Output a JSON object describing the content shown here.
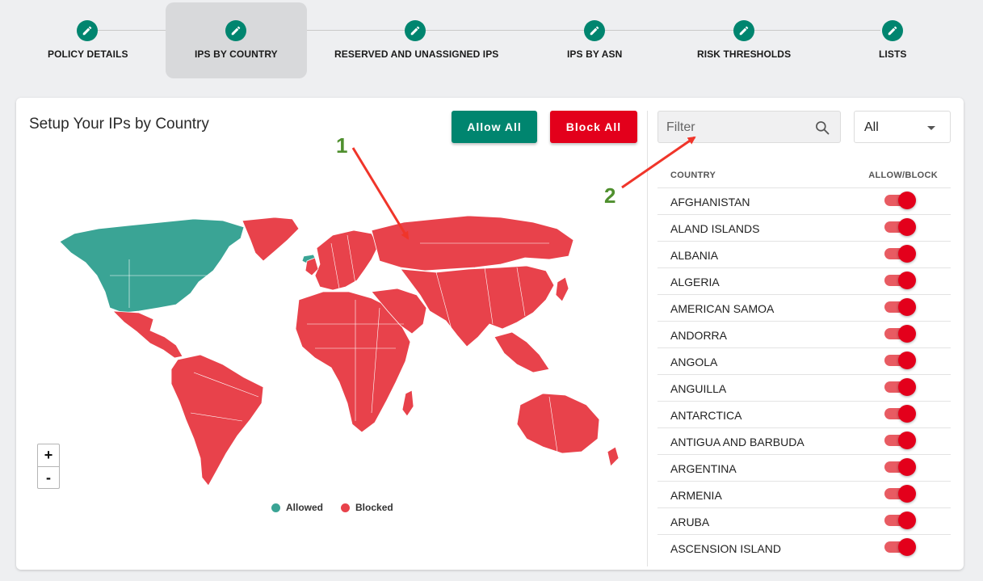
{
  "stepper": {
    "steps": [
      {
        "label": "POLICY DETAILS"
      },
      {
        "label": "IPS BY COUNTRY"
      },
      {
        "label": "RESERVED AND UNASSIGNED IPS"
      },
      {
        "label": "IPS BY ASN"
      },
      {
        "label": "RISK THRESHOLDS"
      },
      {
        "label": "LISTS"
      }
    ],
    "icon": "pencil-icon",
    "active_index": 1
  },
  "card": {
    "title": "Setup Your IPs by Country",
    "allow_all_label": "Allow All",
    "block_all_label": "Block All"
  },
  "map": {
    "zoom_in_label": "+",
    "zoom_out_label": "-",
    "legend": {
      "allowed": "Allowed",
      "blocked": "Blocked"
    },
    "colors": {
      "allowed": "#3aa495",
      "blocked": "#e8424b"
    }
  },
  "filter": {
    "placeholder": "Filter",
    "value": ""
  },
  "select": {
    "value": "All"
  },
  "table": {
    "col_country": "COUNTRY",
    "col_allow_block": "ALLOW/BLOCK",
    "rows": [
      "AFGHANISTAN",
      "ALAND ISLANDS",
      "ALBANIA",
      "ALGERIA",
      "AMERICAN SAMOA",
      "ANDORRA",
      "ANGOLA",
      "ANGUILLA",
      "ANTARCTICA",
      "ANTIGUA AND BARBUDA",
      "ARGENTINA",
      "ARMENIA",
      "ARUBA",
      "ASCENSION ISLAND"
    ]
  },
  "annotations": {
    "one": "1",
    "two": "2"
  },
  "colors": {
    "primary": "#00856f",
    "danger": "#e3001b"
  }
}
